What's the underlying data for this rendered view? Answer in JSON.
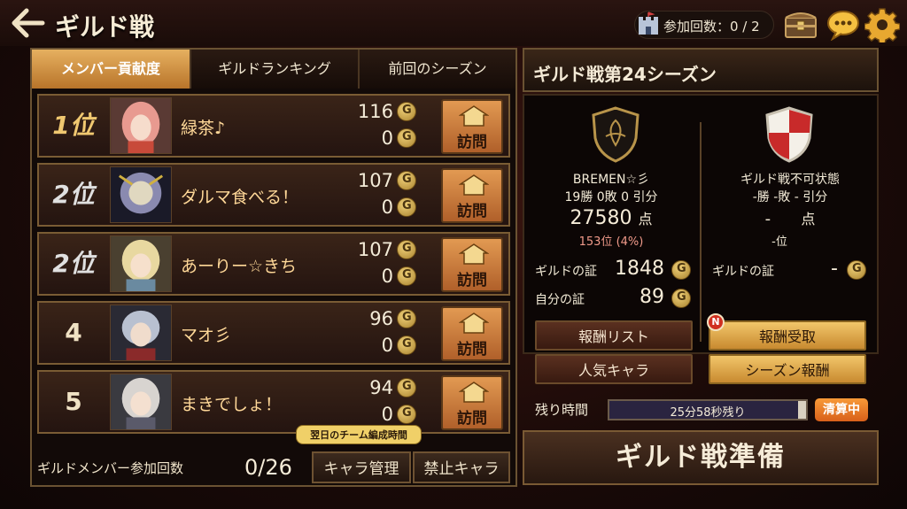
{
  "header": {
    "title": "ギルド戦",
    "participation": "参加回数：0 / 2"
  },
  "tabs": [
    {
      "label": "メンバー貢献度",
      "active": true
    },
    {
      "label": "ギルドランキング",
      "active": false
    },
    {
      "label": "前回のシーズン",
      "active": false
    }
  ],
  "members": [
    {
      "rank": "1位",
      "name": "緑茶♪",
      "coins1": "116",
      "coins2": "0",
      "visit": "訪問"
    },
    {
      "rank": "2位",
      "name": "ダルマ食べる！",
      "coins1": "107",
      "coins2": "0",
      "visit": "訪問"
    },
    {
      "rank": "2位",
      "name": "あーりー☆きち",
      "coins1": "107",
      "coins2": "0",
      "visit": "訪問"
    },
    {
      "rank": "4",
      "name": "マオ彡",
      "coins1": "96",
      "coins2": "0",
      "visit": "訪問"
    },
    {
      "rank": "5",
      "name": "まきでしょ！",
      "coins1": "94",
      "coins2": "0",
      "visit": "訪問"
    }
  ],
  "footer_left": {
    "member_label": "ギルドメンバー参加回数",
    "member_count": "0/26",
    "tooltip": "翌日のチーム編成時間",
    "chara_manage": "キャラ管理",
    "banned_chara": "禁止キャラ"
  },
  "season": {
    "title": "ギルド戦第24シーズン",
    "left": {
      "name": "BREMEN☆彡",
      "record": "19勝 0敗 0 引分",
      "points": "27580",
      "points_unit": "点",
      "rank": "153位 (4%)",
      "guild_proof_label": "ギルドの証",
      "guild_proof": "1848",
      "self_proof_label": "自分の証",
      "self_proof": "89"
    },
    "right": {
      "name": "ギルド戦不可状態",
      "record": "-勝 -敗 - 引分",
      "points": "-",
      "points_unit": "点",
      "rank": "-位",
      "guild_proof_label": "ギルドの証",
      "guild_proof": "-"
    },
    "buttons": {
      "reward_list": "報酬リスト",
      "reward_receive": "報酬受取",
      "popular_chara": "人気キャラ",
      "season_reward": "シーズン報酬",
      "badge": "N"
    },
    "time_label": "残り時間",
    "time_left": "25分58秒残り",
    "time_progress": 0.04,
    "settle": "清算中",
    "prepare": "ギルド戦準備"
  },
  "colors": {
    "accent_gold": "#e6b060",
    "panel_border": "#6a5232",
    "settle_orange": "#f89a38"
  }
}
